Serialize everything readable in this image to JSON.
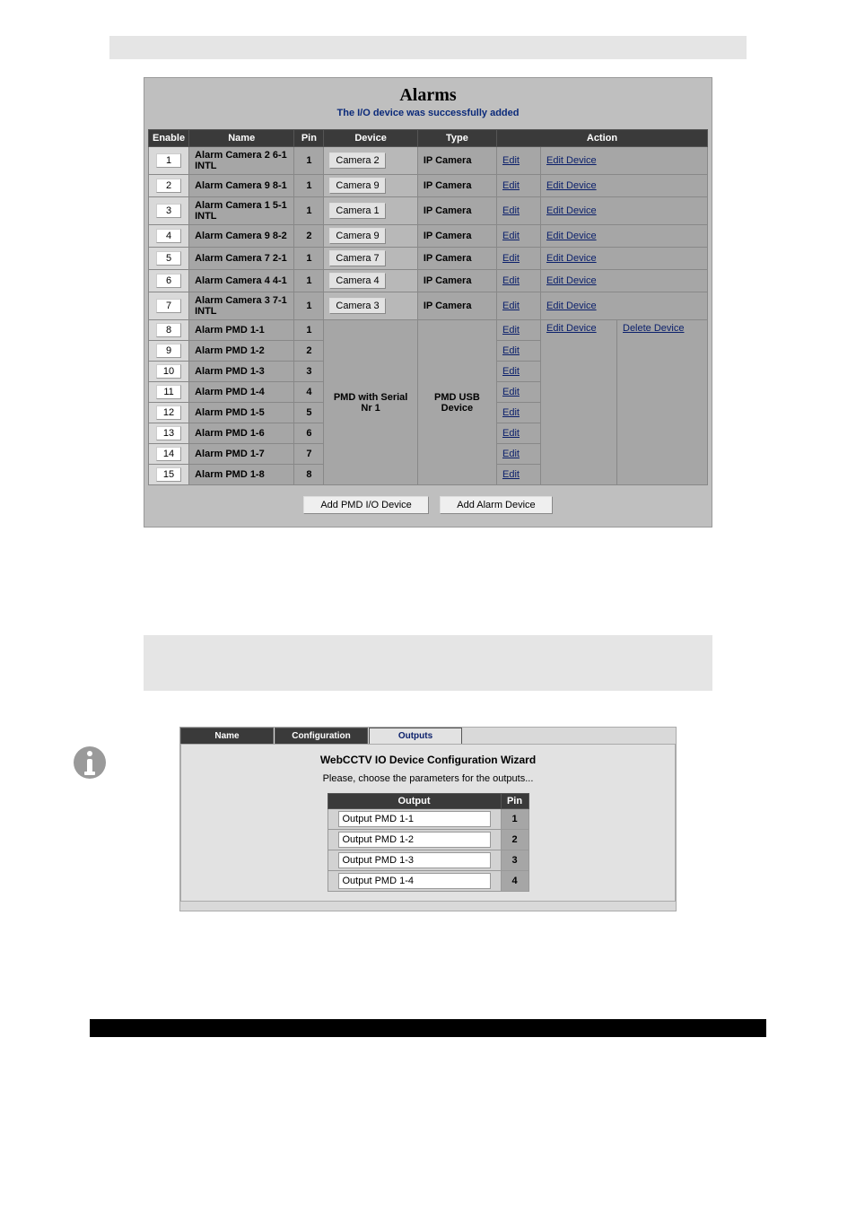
{
  "alarms": {
    "title": "Alarms",
    "status": "The I/O device was successfully added",
    "headers": {
      "enable": "Enable",
      "name": "Name",
      "pin": "Pin",
      "device": "Device",
      "type": "Type",
      "action": "Action"
    },
    "rows": [
      {
        "enable": "1",
        "name": "Alarm Camera 2 6-1 INTL",
        "pin": "1",
        "device": "Camera 2",
        "devicebox": true,
        "type": "IP Camera",
        "edit": "Edit",
        "edit_device": "Edit Device",
        "delete_device": ""
      },
      {
        "enable": "2",
        "name": "Alarm Camera 9 8-1",
        "pin": "1",
        "device": "Camera 9",
        "devicebox": true,
        "type": "IP Camera",
        "edit": "Edit",
        "edit_device": "Edit Device",
        "delete_device": ""
      },
      {
        "enable": "3",
        "name": "Alarm Camera 1 5-1 INTL",
        "pin": "1",
        "device": "Camera 1",
        "devicebox": true,
        "type": "IP Camera",
        "edit": "Edit",
        "edit_device": "Edit Device",
        "delete_device": ""
      },
      {
        "enable": "4",
        "name": "Alarm Camera 9 8-2",
        "pin": "2",
        "device": "Camera 9",
        "devicebox": true,
        "type": "IP Camera",
        "edit": "Edit",
        "edit_device": "Edit Device",
        "delete_device": ""
      },
      {
        "enable": "5",
        "name": "Alarm Camera 7 2-1",
        "pin": "1",
        "device": "Camera 7",
        "devicebox": true,
        "type": "IP Camera",
        "edit": "Edit",
        "edit_device": "Edit Device",
        "delete_device": ""
      },
      {
        "enable": "6",
        "name": "Alarm Camera 4 4-1",
        "pin": "1",
        "device": "Camera 4",
        "devicebox": true,
        "type": "IP Camera",
        "edit": "Edit",
        "edit_device": "Edit Device",
        "delete_device": ""
      },
      {
        "enable": "7",
        "name": "Alarm Camera 3 7-1 INTL",
        "pin": "1",
        "device": "Camera 3",
        "devicebox": true,
        "type": "IP Camera",
        "edit": "Edit",
        "edit_device": "Edit Device",
        "delete_device": ""
      },
      {
        "enable": "8",
        "name": "Alarm PMD 1-1",
        "pin": "1",
        "device": "",
        "type": "",
        "edit": "Edit",
        "edit_device": "Edit Device",
        "delete_device": "Delete Device",
        "group_start": true
      },
      {
        "enable": "9",
        "name": "Alarm PMD 1-2",
        "pin": "2",
        "device": "",
        "type": "",
        "edit": "Edit",
        "edit_device": "",
        "delete_device": ""
      },
      {
        "enable": "10",
        "name": "Alarm PMD 1-3",
        "pin": "3",
        "device": "",
        "type": "",
        "edit": "Edit",
        "edit_device": "",
        "delete_device": ""
      },
      {
        "enable": "11",
        "name": "Alarm PMD 1-4",
        "pin": "4",
        "device": "",
        "type": "",
        "edit": "Edit",
        "edit_device": "",
        "delete_device": ""
      },
      {
        "enable": "12",
        "name": "Alarm PMD 1-5",
        "pin": "5",
        "device": "",
        "type": "",
        "edit": "Edit",
        "edit_device": "",
        "delete_device": ""
      },
      {
        "enable": "13",
        "name": "Alarm PMD 1-6",
        "pin": "6",
        "device": "",
        "type": "",
        "edit": "Edit",
        "edit_device": "",
        "delete_device": ""
      },
      {
        "enable": "14",
        "name": "Alarm PMD 1-7",
        "pin": "7",
        "device": "",
        "type": "",
        "edit": "Edit",
        "edit_device": "",
        "delete_device": ""
      },
      {
        "enable": "15",
        "name": "Alarm PMD 1-8",
        "pin": "8",
        "device": "",
        "type": "",
        "edit": "Edit",
        "edit_device": "",
        "delete_device": ""
      }
    ],
    "group_device": "PMD with Serial Nr 1",
    "group_type": "PMD USB Device",
    "btn_add_pmd": "Add PMD I/O Device",
    "btn_add_alarm": "Add Alarm Device"
  },
  "wizard": {
    "tabs": {
      "name": "Name",
      "config": "Configuration",
      "outputs": "Outputs"
    },
    "title": "WebCCTV IO Device Configuration Wizard",
    "subtitle": "Please, choose the parameters for the outputs...",
    "out_header": "Output",
    "pin_header": "Pin",
    "rows": [
      {
        "name": "Output PMD 1-1",
        "pin": "1"
      },
      {
        "name": "Output PMD 1-2",
        "pin": "2"
      },
      {
        "name": "Output PMD 1-3",
        "pin": "3"
      },
      {
        "name": "Output PMD 1-4",
        "pin": "4"
      }
    ]
  }
}
